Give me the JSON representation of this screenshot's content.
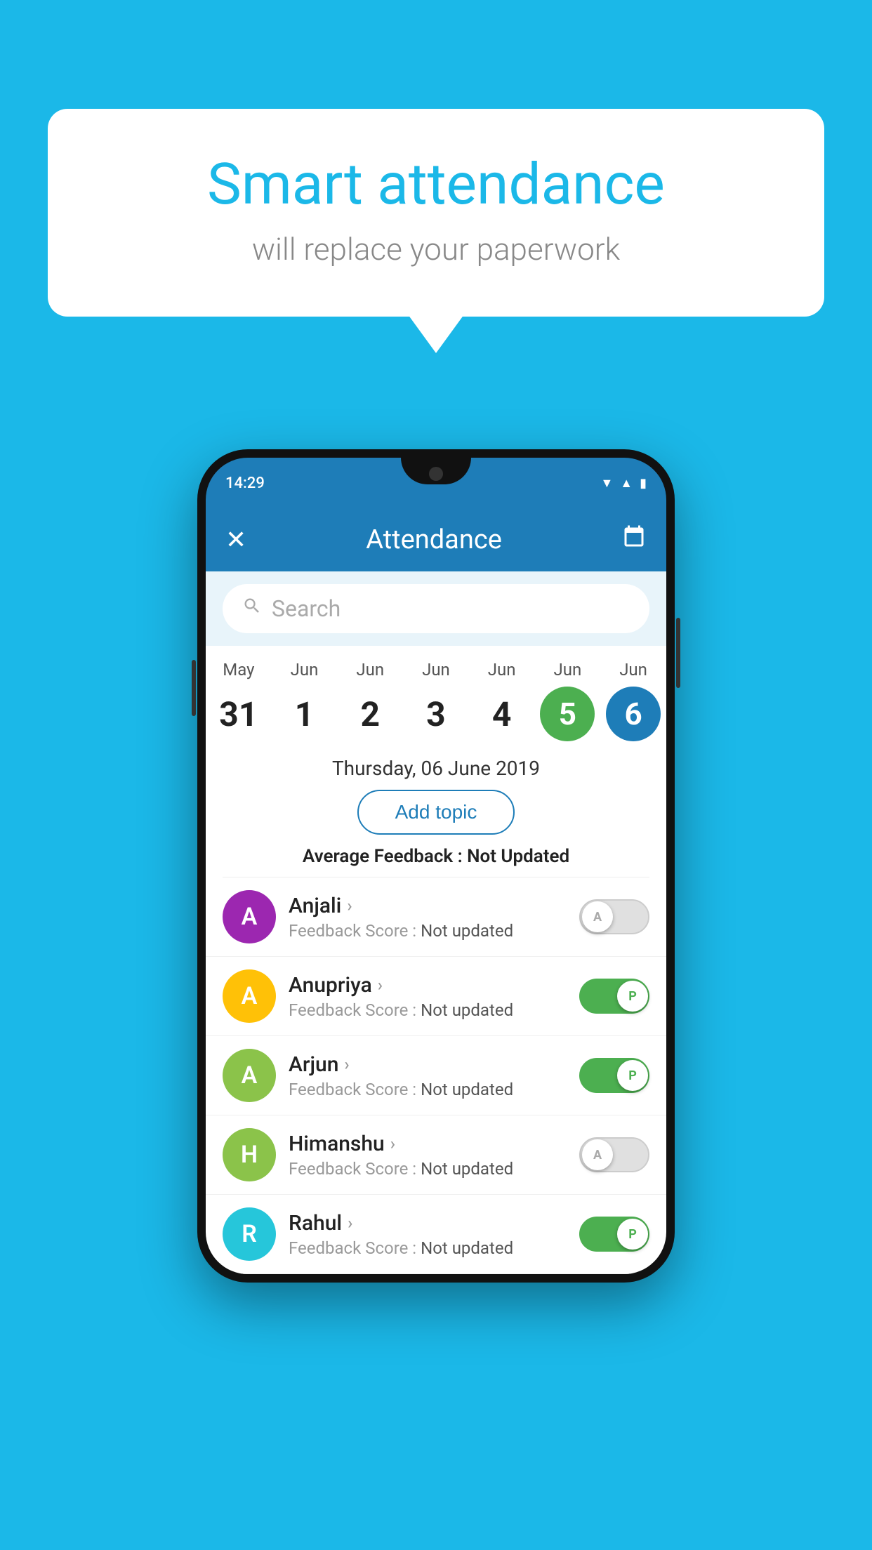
{
  "background": {
    "color": "#1BB8E8"
  },
  "speech_bubble": {
    "title": "Smart attendance",
    "subtitle": "will replace your paperwork"
  },
  "phone": {
    "status_bar": {
      "time": "14:29"
    },
    "header": {
      "close_label": "✕",
      "title": "Attendance",
      "calendar_icon": "📅"
    },
    "search": {
      "placeholder": "Search"
    },
    "date_strip": {
      "dates": [
        {
          "month": "May",
          "day": "31",
          "state": "normal"
        },
        {
          "month": "Jun",
          "day": "1",
          "state": "normal"
        },
        {
          "month": "Jun",
          "day": "2",
          "state": "normal"
        },
        {
          "month": "Jun",
          "day": "3",
          "state": "normal"
        },
        {
          "month": "Jun",
          "day": "4",
          "state": "normal"
        },
        {
          "month": "Jun",
          "day": "5",
          "state": "today"
        },
        {
          "month": "Jun",
          "day": "6",
          "state": "selected"
        }
      ]
    },
    "selected_date_label": "Thursday, 06 June 2019",
    "add_topic_label": "Add topic",
    "avg_feedback_prefix": "Average Feedback : ",
    "avg_feedback_value": "Not Updated",
    "students": [
      {
        "name": "Anjali",
        "avatar_letter": "A",
        "avatar_color": "#9C27B0",
        "feedback_prefix": "Feedback Score : ",
        "feedback_value": "Not updated",
        "toggle_state": "off",
        "toggle_label": "A"
      },
      {
        "name": "Anupriya",
        "avatar_letter": "A",
        "avatar_color": "#FFC107",
        "feedback_prefix": "Feedback Score : ",
        "feedback_value": "Not updated",
        "toggle_state": "on",
        "toggle_label": "P"
      },
      {
        "name": "Arjun",
        "avatar_letter": "A",
        "avatar_color": "#8BC34A",
        "feedback_prefix": "Feedback Score : ",
        "feedback_value": "Not updated",
        "toggle_state": "on",
        "toggle_label": "P"
      },
      {
        "name": "Himanshu",
        "avatar_letter": "H",
        "avatar_color": "#8BC34A",
        "feedback_prefix": "Feedback Score : ",
        "feedback_value": "Not updated",
        "toggle_state": "off",
        "toggle_label": "A"
      },
      {
        "name": "Rahul",
        "avatar_letter": "R",
        "avatar_color": "#26C6DA",
        "feedback_prefix": "Feedback Score : ",
        "feedback_value": "Not updated",
        "toggle_state": "on",
        "toggle_label": "P"
      }
    ]
  }
}
